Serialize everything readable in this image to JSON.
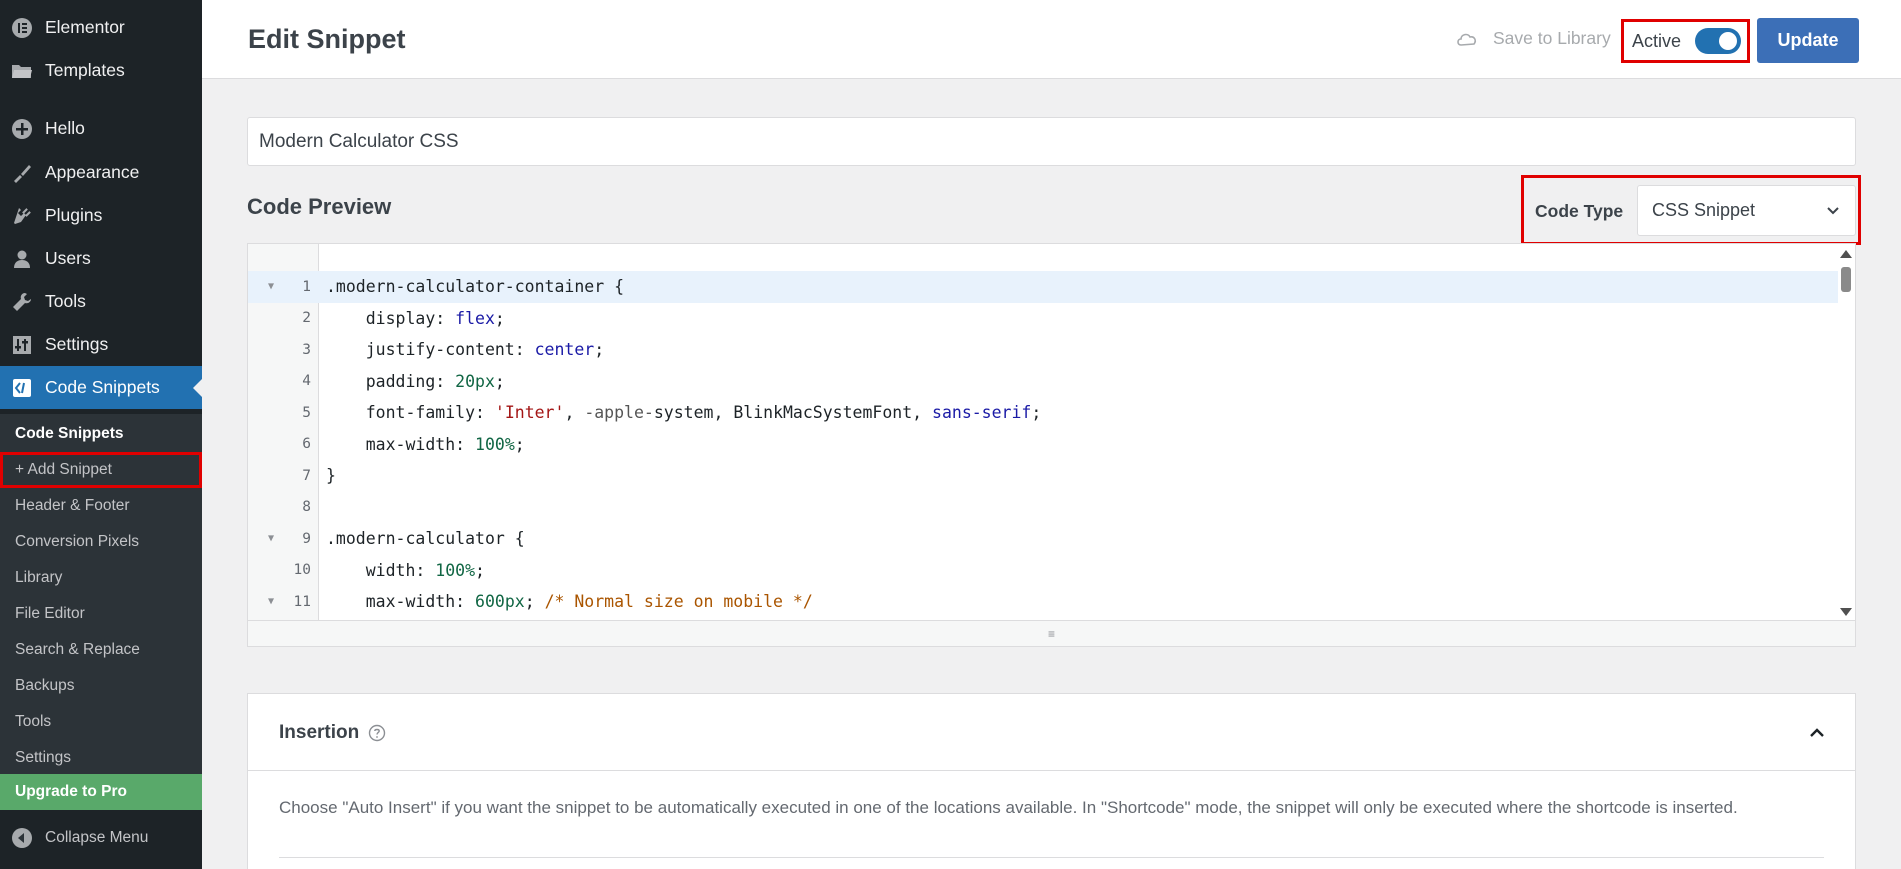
{
  "sidebar": {
    "items": [
      {
        "label": "Elementor",
        "icon": "elementor-icon"
      },
      {
        "label": "Templates",
        "icon": "folder-icon"
      },
      {
        "label": "Hello",
        "icon": "plus-circle-icon"
      },
      {
        "label": "Appearance",
        "icon": "brush-icon"
      },
      {
        "label": "Plugins",
        "icon": "plug-icon"
      },
      {
        "label": "Users",
        "icon": "user-icon"
      },
      {
        "label": "Tools",
        "icon": "wrench-icon"
      },
      {
        "label": "Settings",
        "icon": "sliders-icon"
      },
      {
        "label": "Code Snippets",
        "icon": "code-icon"
      }
    ],
    "submenu": [
      "Code Snippets",
      "+ Add Snippet",
      "Header & Footer",
      "Conversion Pixels",
      "Library",
      "File Editor",
      "Search & Replace",
      "Backups",
      "Tools",
      "Settings"
    ],
    "upgrade": "Upgrade to Pro",
    "collapse": "Collapse Menu"
  },
  "header": {
    "title": "Edit Snippet",
    "save_to_library": "Save to Library",
    "active_label": "Active",
    "active": true,
    "update": "Update"
  },
  "snippet": {
    "title": "Modern Calculator CSS",
    "code_preview_heading": "Code Preview",
    "code_type_label": "Code Type",
    "code_type_value": "CSS Snippet"
  },
  "code": {
    "line_numbers": [
      "1",
      "2",
      "3",
      "4",
      "5",
      "6",
      "7",
      "8",
      "9",
      "10",
      "11"
    ],
    "resize_handle": "≡"
  },
  "insertion": {
    "title": "Insertion",
    "description": "Choose \"Auto Insert\" if you want the snippet to be automatically executed in one of the locations available. In \"Shortcode\" mode, the snippet will only be executed where the shortcode is inserted."
  },
  "colors": {
    "sidebar_bg": "#1d2327",
    "submenu_bg": "#2c3338",
    "active_menu": "#2271b1",
    "upgrade": "#59a96a",
    "update_button": "#3c6fb7",
    "highlight_border": "#e00000"
  }
}
